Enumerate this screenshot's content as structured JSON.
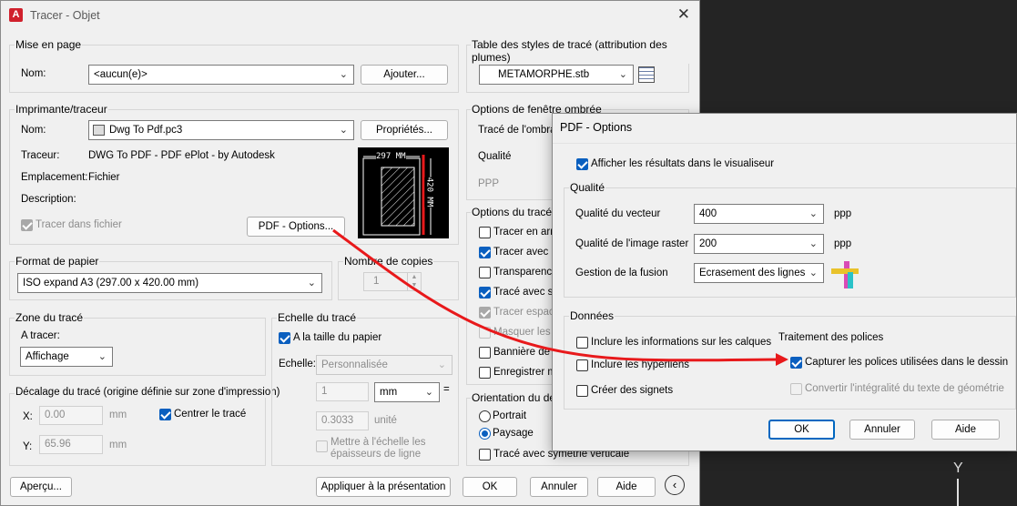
{
  "main": {
    "title": "Tracer - Objet",
    "app_icon_letter": "A",
    "mise_en_page": {
      "group_title": "Mise en page",
      "nom_label": "Nom:",
      "nom_value": "<aucun(e)>",
      "ajouter_button": "Ajouter..."
    },
    "imprimante": {
      "group_title": "Imprimante/traceur",
      "nom_label": "Nom:",
      "nom_value": "Dwg To Pdf.pc3",
      "proprietes_button": "Propriétés...",
      "traceur_label": "Traceur:",
      "traceur_value": "DWG To PDF - PDF ePlot - by Autodesk",
      "emplacement_label": "Emplacement:",
      "emplacement_value": "Fichier",
      "description_label": "Description:",
      "tracer_fichier_label": "Tracer dans fichier",
      "pdf_options_button": "PDF - Options...",
      "preview_width": "297 MM",
      "preview_height": "420 MM"
    },
    "format_papier": {
      "group_title": "Format de papier",
      "value": "ISO expand A3 (297.00 x 420.00 mm)"
    },
    "nombre_copies": {
      "group_title": "Nombre de copies",
      "value": "1"
    },
    "zone_trace": {
      "group_title": "Zone du tracé",
      "a_tracer_label": "A tracer:",
      "value": "Affichage"
    },
    "echelle": {
      "group_title": "Echelle du tracé",
      "taille_papier_label": "A la taille du papier",
      "echelle_label": "Echelle:",
      "echelle_value": "Personnalisée",
      "value_1": "1",
      "unit_mm": "mm",
      "equals": "=",
      "value_2": "0.3033",
      "unit_label": "unité",
      "mettre_label_1": "Mettre à l'échelle les",
      "mettre_label_2": "épaisseurs de ligne"
    },
    "decalage": {
      "group_title": "Décalage du tracé (origine définie sur zone d'impression)",
      "x_label": "X:",
      "x_value": "0.00",
      "x_unit": "mm",
      "y_label": "Y:",
      "y_value": "65.96",
      "y_unit": "mm",
      "centrer_label": "Centrer le tracé"
    },
    "table_styles": {
      "group_title": "Table des styles de tracé (attribution des plumes)",
      "value": "METAMORPHE.stb"
    },
    "fenetre_ombree": {
      "group_title": "Options de fenêtre ombrée",
      "trace_ombrage_label": "Tracé de l'ombrag",
      "qualite_label": "Qualité",
      "ppp_label": "PPP"
    },
    "options_trace": {
      "group_title": "Options du tracé",
      "items": [
        {
          "label": "Tracer en arri",
          "checked": false,
          "enabled": true
        },
        {
          "label": "Tracer avec é",
          "checked": true,
          "enabled": true
        },
        {
          "label": "Transparence",
          "checked": false,
          "enabled": true
        },
        {
          "label": "Tracé avec st",
          "checked": true,
          "enabled": true
        },
        {
          "label": "Tracer espace",
          "checked": true,
          "enabled": false
        },
        {
          "label": "Masquer les o",
          "checked": false,
          "enabled": false
        },
        {
          "label": "Bannière de t",
          "checked": false,
          "enabled": true
        },
        {
          "label": "Enregistrer m",
          "checked": false,
          "enabled": true
        }
      ]
    },
    "orientation": {
      "group_title": "Orientation du des",
      "portrait_label": "Portrait",
      "paysage_label": "Paysage",
      "symetrie_label": "Tracé avec symétrie verticale"
    },
    "footer": {
      "apercu_button": "Aperçu...",
      "appliquer_button": "Appliquer à la présentation",
      "ok_button": "OK",
      "annuler_button": "Annuler",
      "aide_button": "Aide"
    }
  },
  "pdf_options": {
    "title": "PDF - Options",
    "afficher_label": "Afficher les résultats dans le visualiseur",
    "qualite": {
      "group_title": "Qualité",
      "vecteur_label": "Qualité du vecteur",
      "vecteur_value": "400",
      "raster_label": "Qualité de l'image raster",
      "raster_value": "200",
      "fusion_label": "Gestion de la fusion",
      "fusion_value": "Ecrasement des lignes",
      "ppp_unit": "ppp"
    },
    "donnees": {
      "group_title": "Données",
      "calques_label": "Inclure les informations sur les calques",
      "hyperliens_label": "Inclure les hyperliens",
      "signets_label": "Créer des signets",
      "polices_title": "Traitement des polices",
      "capturer_label": "Capturer les polices utilisées dans le dessin",
      "convertir_label": "Convertir l'intégralité du texte de géométrie"
    },
    "ok_button": "OK",
    "annuler_button": "Annuler",
    "aide_button": "Aide"
  },
  "background": {
    "axis_label": "Y"
  },
  "colors": {
    "accent": "#0a5fbf",
    "annotation_arrow": "#e8191b",
    "app_icon": "#d0202c"
  }
}
